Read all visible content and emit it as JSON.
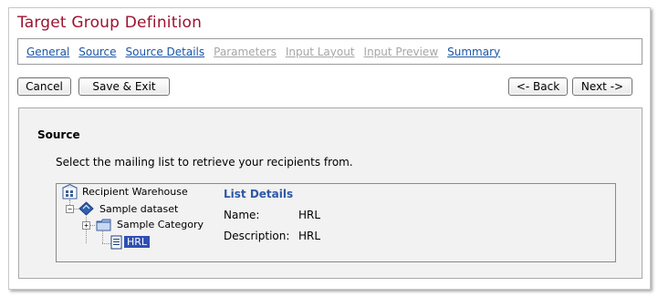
{
  "window": {
    "title": "Target Group Definition"
  },
  "tabs": [
    {
      "label": "General",
      "state": "link"
    },
    {
      "label": "Source",
      "state": "current"
    },
    {
      "label": "Source Details",
      "state": "link"
    },
    {
      "label": "Parameters",
      "state": "disabled"
    },
    {
      "label": "Input Layout",
      "state": "disabled"
    },
    {
      "label": "Input Preview",
      "state": "disabled"
    },
    {
      "label": "Summary",
      "state": "link"
    }
  ],
  "toolbar": {
    "cancel_label": "Cancel",
    "save_exit_label": "Save & Exit",
    "back_label": "<- Back",
    "next_label": "Next ->"
  },
  "section": {
    "title": "Source",
    "instruction": "Select the mailing list to retrieve your recipients from."
  },
  "tree": {
    "root": {
      "label": "Recipient Warehouse",
      "icon": "warehouse-icon"
    },
    "dataset": {
      "label": "Sample dataset",
      "icon": "dataset-icon"
    },
    "category": {
      "label": "Sample Category",
      "icon": "folder-icon"
    },
    "list": {
      "label": "HRL",
      "icon": "list-icon",
      "selected": true
    }
  },
  "details": {
    "title": "List Details",
    "name_label": "Name:",
    "name_value": "HRL",
    "description_label": "Description:",
    "description_value": "HRL"
  },
  "colors": {
    "title": "#9c1230",
    "link": "#1a55a6",
    "disabled": "#a6a6a6",
    "selection": "#2f4fb3",
    "details_title": "#2d58a8"
  }
}
